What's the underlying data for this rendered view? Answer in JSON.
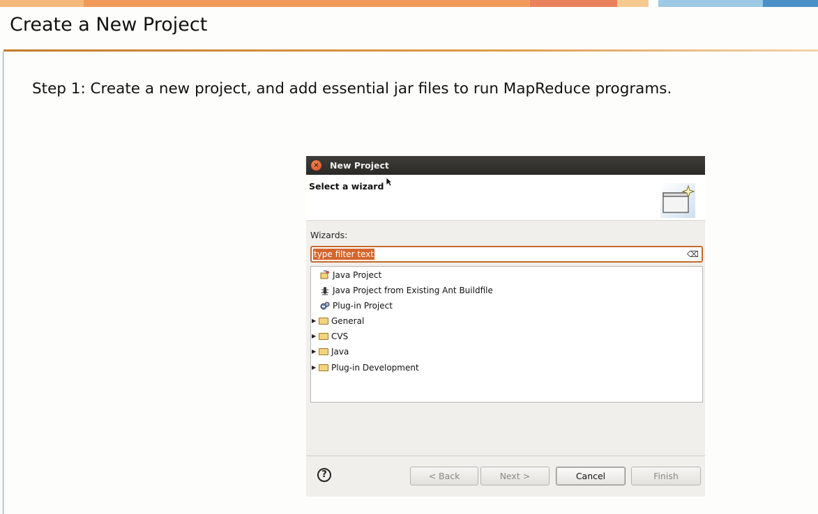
{
  "slide": {
    "title": "Create a New Project",
    "step_text": "Step 1: Create a new project, and add essential jar files to run MapReduce programs.",
    "stripe_colors": [
      "#f4b87a",
      "#f29a5a",
      "#e9825c",
      "#f6c98e",
      "#ffffff",
      "#9ec9e6",
      "#4a90c8"
    ]
  },
  "dialog": {
    "title": "New Project",
    "banner_title": "Select a wizard",
    "wizards_label": "Wizards:",
    "filter": {
      "value": "type filter text",
      "clear_icon": "clear-filter-icon"
    },
    "items": [
      {
        "label": "Java Project",
        "icon": "java-project-icon",
        "type": "wizard"
      },
      {
        "label": "Java Project from Existing Ant Buildfile",
        "icon": "ant-icon",
        "type": "wizard"
      },
      {
        "label": "Plug-in Project",
        "icon": "plugin-project-icon",
        "type": "wizard"
      },
      {
        "label": "General",
        "icon": "folder-icon",
        "type": "category"
      },
      {
        "label": "CVS",
        "icon": "folder-icon",
        "type": "category"
      },
      {
        "label": "Java",
        "icon": "folder-icon",
        "type": "category"
      },
      {
        "label": "Plug-in Development",
        "icon": "folder-icon",
        "type": "category"
      }
    ],
    "buttons": {
      "help": "?",
      "back": "< Back",
      "next": "Next >",
      "cancel": "Cancel",
      "finish": "Finish"
    }
  }
}
